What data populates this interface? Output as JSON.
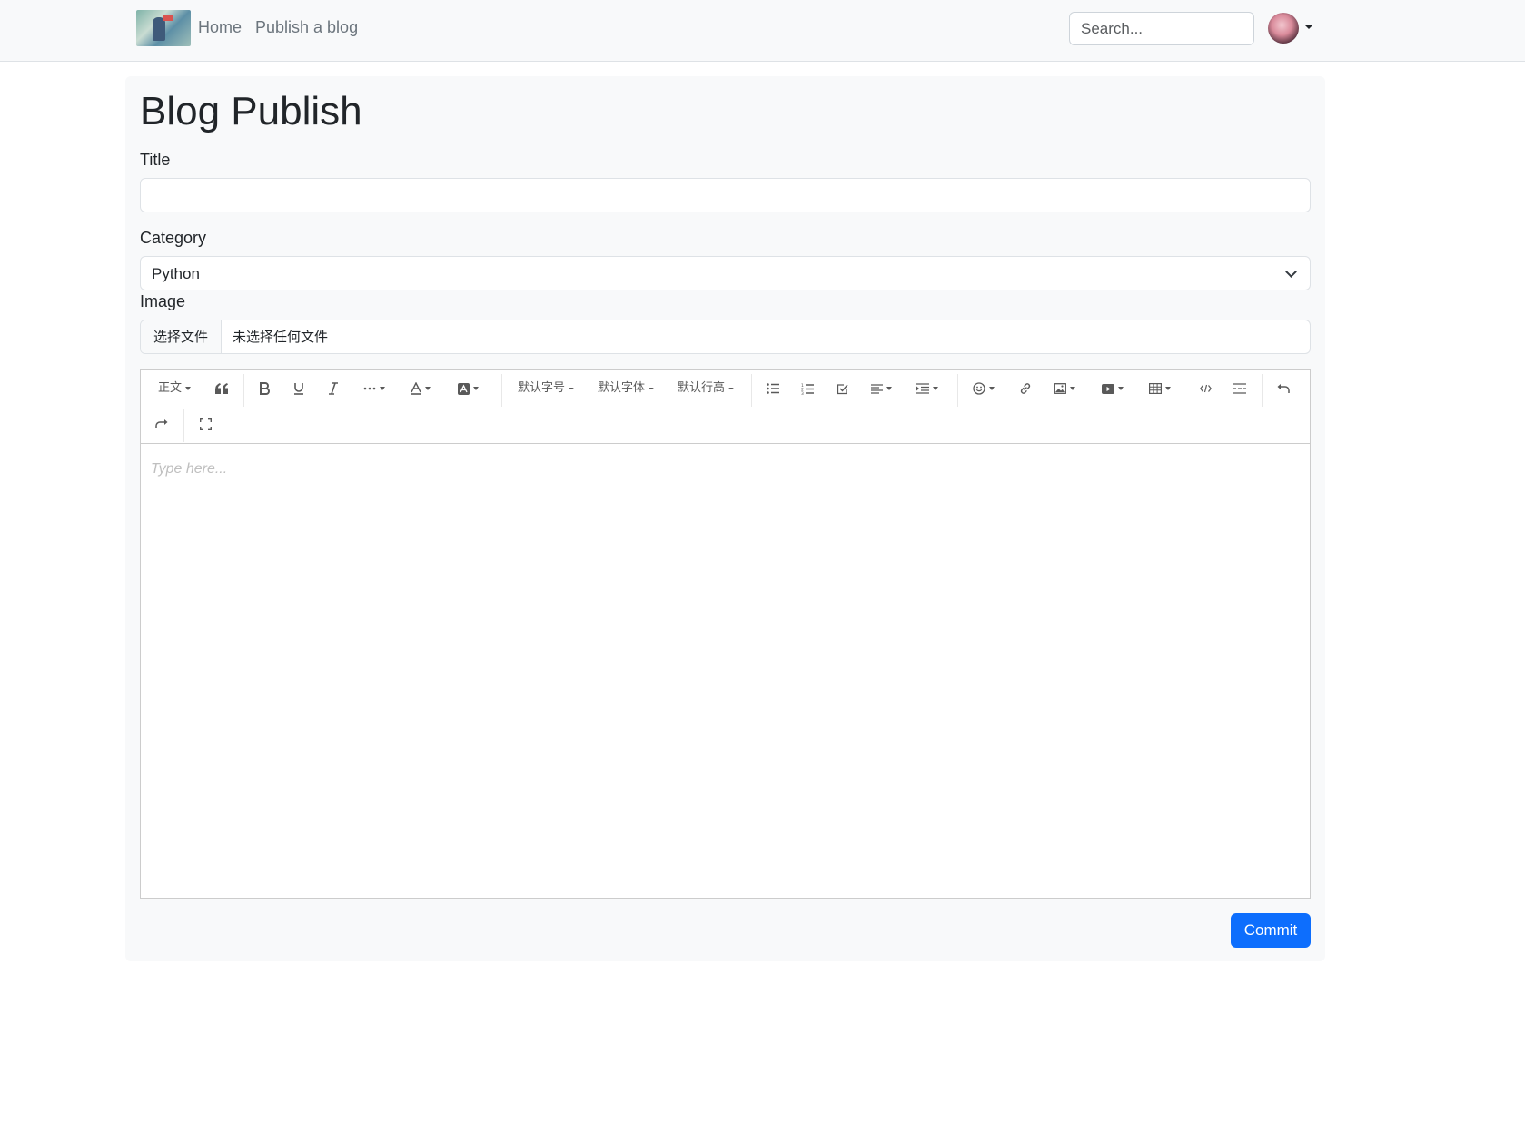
{
  "navbar": {
    "home_label": "Home",
    "publish_label": "Publish a blog",
    "search_placeholder": "Search..."
  },
  "page": {
    "title": "Blog Publish"
  },
  "form": {
    "title_label": "Title",
    "title_value": "",
    "category_label": "Category",
    "category_selected": "Python",
    "image_label": "Image",
    "file_button_label": "选择文件",
    "file_status": "未选择任何文件",
    "editor_placeholder": "Type here...",
    "commit_label": "Commit"
  },
  "toolbar": {
    "header_select": "正文",
    "font_size": "默认字号",
    "font_family": "默认字体",
    "line_height": "默认行高",
    "items": [
      "header-select",
      "blockquote",
      "bold",
      "underline",
      "italic",
      "more",
      "font-color",
      "bg-color",
      "font-size",
      "font-family",
      "line-height",
      "bulleted-list",
      "numbered-list",
      "todo",
      "justify",
      "indent",
      "emotion",
      "link",
      "image",
      "video",
      "table",
      "code-block",
      "divider",
      "undo",
      "redo",
      "fullscreen"
    ]
  },
  "colors": {
    "accent": "#0d6efd",
    "navbar_bg": "#f8f9fa",
    "panel_bg": "#f8f9fa"
  }
}
